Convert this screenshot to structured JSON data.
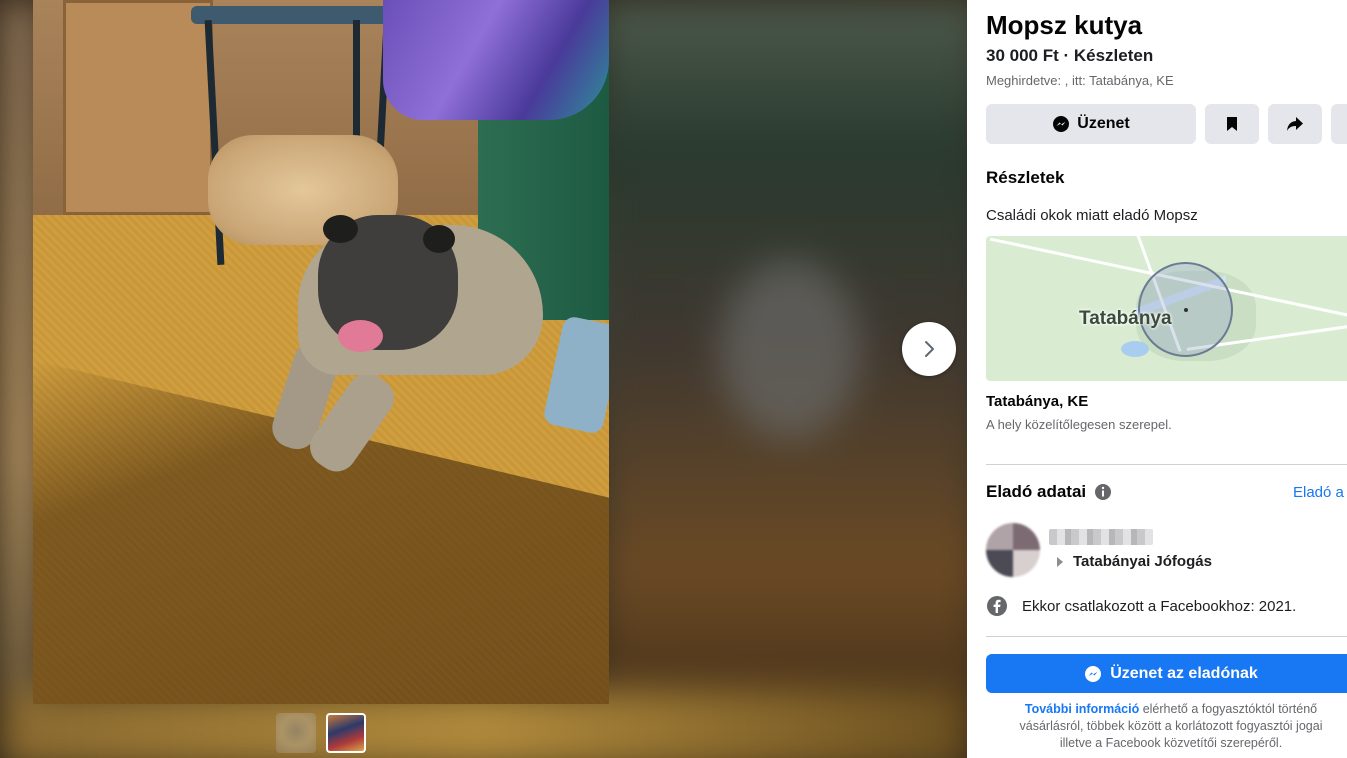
{
  "listing": {
    "title": "Mopsz kutya",
    "price_line": "30 000 Ft · Készleten",
    "posted_line": "Meghirdetve: , itt: Tatabánya, KE"
  },
  "actions": {
    "message_label": "Üzenet",
    "save_icon": "bookmark-icon",
    "share_icon": "share-icon"
  },
  "details": {
    "heading": "Részletek",
    "description": "Családi okok miatt eladó Mopsz"
  },
  "map": {
    "label": "Tatabánya"
  },
  "location": {
    "name": "Tatabánya, KE",
    "note": "A hely közelítőlegesen szerepel."
  },
  "seller": {
    "heading": "Eladó adatai",
    "details_link": "Eladó a",
    "group": "Tatabányai Jófogás",
    "joined": "Ekkor csatlakozott a Facebookhoz: 2021."
  },
  "cta": {
    "label": "Üzenet az eladónak"
  },
  "legal": {
    "link": "További információ",
    "text_1": " elérhető a fogyasztóktól történő",
    "text_2": "vásárlásról, többek között a korlátozott fogyasztói jogai",
    "text_3": "illetve a Facebook közvetítői szerepéről."
  },
  "colors": {
    "primary": "#1877f2",
    "button_gray": "#e4e6eb",
    "text_secondary": "#65676b"
  }
}
